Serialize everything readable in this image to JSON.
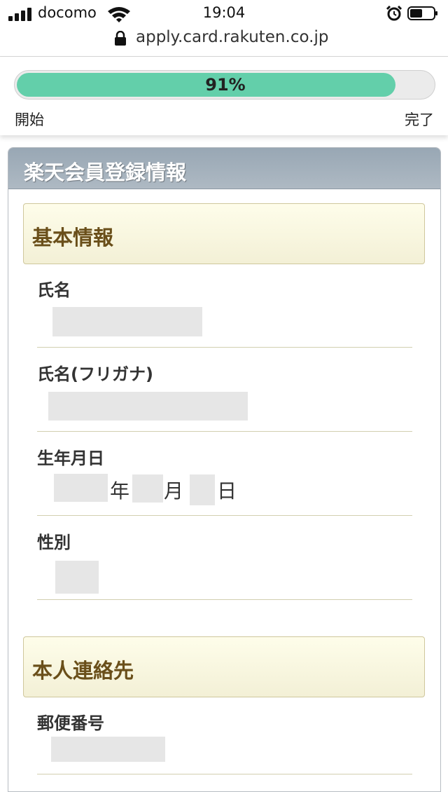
{
  "status_bar": {
    "carrier": "docomo",
    "time": "19:04"
  },
  "url_bar": {
    "url": "apply.card.rakuten.co.jp"
  },
  "progress": {
    "percent_label": "91%",
    "fraction": 0.91,
    "start_label": "開始",
    "end_label": "完了",
    "fill_color": "#63cfaa"
  },
  "panel": {
    "title": "楽天会員登録情報",
    "sections": [
      {
        "title": "基本情報",
        "fields": {
          "name": "氏名",
          "furigana": "氏名(フリガナ)",
          "birthdate": "生年月日",
          "gender": "性別"
        },
        "birthdate_units": {
          "year": "年",
          "month": "月",
          "day": "日"
        }
      },
      {
        "title": "本人連絡先",
        "fields": {
          "postal_code": "郵便番号"
        }
      }
    ]
  }
}
